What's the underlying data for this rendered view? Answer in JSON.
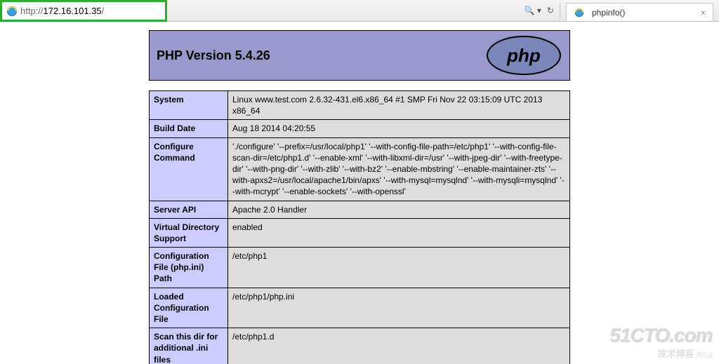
{
  "browser": {
    "url_prefix": "http://",
    "url_host": "172.16.101.35",
    "url_suffix": "/",
    "search_glyph": "🔍",
    "dropdown_glyph": "▾",
    "refresh_glyph": "↻",
    "tab_title": "phpinfo()",
    "tab_close": "×"
  },
  "phpinfo": {
    "title": "PHP Version 5.4.26",
    "rows": [
      {
        "key": "System",
        "val": "Linux www.test.com 2.6.32-431.el6.x86_64 #1 SMP Fri Nov 22 03:15:09 UTC 2013 x86_64"
      },
      {
        "key": "Build Date",
        "val": "Aug 18 2014 04:20:55"
      },
      {
        "key": "Configure Command",
        "val": "'./configure' '--prefix=/usr/local/php1' '--with-config-file-path=/etc/php1' '--with-config-file-scan-dir=/etc/php1.d' '--enable-xml' '--with-libxml-dir=/usr' '--with-jpeg-dir' '--with-freetype-dir' '--with-png-dir' '--with-zlib' '--with-bz2' '--enable-mbstring' '--enable-maintainer-zts' '--with-apxs2=/usr/local/apache1/bin/apxs' '--with-mysql=mysqlnd' '--with-mysqli=mysqlnd' '--with-mcrypt' '--enable-sockets' '--with-openssl'"
      },
      {
        "key": "Server API",
        "val": "Apache 2.0 Handler"
      },
      {
        "key": "Virtual Directory Support",
        "val": "enabled"
      },
      {
        "key": "Configuration File (php.ini) Path",
        "val": "/etc/php1"
      },
      {
        "key": "Loaded Configuration File",
        "val": "/etc/php1/php.ini"
      },
      {
        "key": "Scan this dir for additional .ini files",
        "val": "/etc/php1.d"
      }
    ]
  },
  "watermark": {
    "main": "51CTO.com",
    "sub": "技术博客",
    "blog": "Blog"
  }
}
